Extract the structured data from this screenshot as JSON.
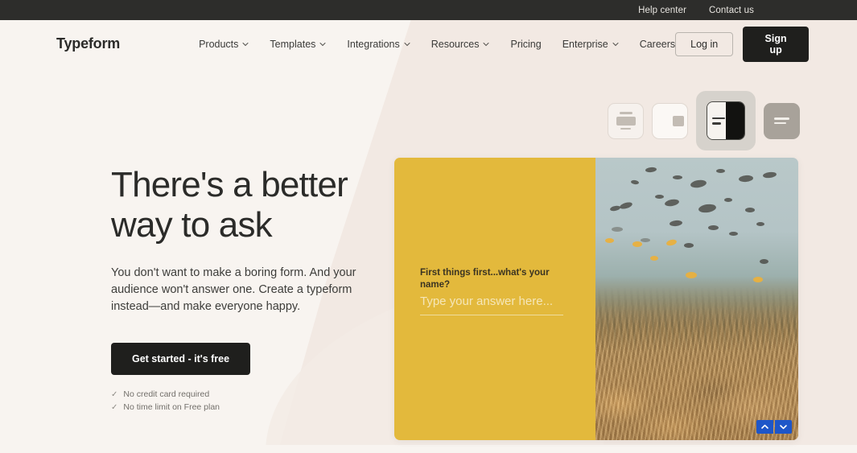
{
  "topbar": {
    "links": [
      {
        "label": "Help center"
      },
      {
        "label": "Contact us"
      }
    ]
  },
  "header": {
    "logo": "Typeform",
    "nav": [
      {
        "label": "Products",
        "has_chevron": true
      },
      {
        "label": "Templates",
        "has_chevron": true
      },
      {
        "label": "Integrations",
        "has_chevron": true
      },
      {
        "label": "Resources",
        "has_chevron": true
      },
      {
        "label": "Pricing",
        "has_chevron": false
      },
      {
        "label": "Enterprise",
        "has_chevron": true
      },
      {
        "label": "Careers",
        "has_chevron": false
      }
    ],
    "login_label": "Log in",
    "signup_label": "Sign up"
  },
  "layout_switcher": {
    "options": [
      {
        "name": "layout-stacked",
        "selected": false
      },
      {
        "name": "layout-side-small",
        "selected": false
      },
      {
        "name": "layout-split",
        "selected": true
      },
      {
        "name": "layout-full",
        "selected": false
      }
    ],
    "selected_index": 2
  },
  "hero": {
    "heading": "There's a better way to ask",
    "paragraph": "You don't want to make a boring form. And your audience won't answer one. Create a typeform instead—and make everyone happy.",
    "cta_label": "Get started - it's free",
    "perks": [
      {
        "tick": "✓",
        "label": "No credit card required"
      },
      {
        "tick": "✓",
        "label": "No time limit on Free plan"
      }
    ]
  },
  "form_preview": {
    "question": "First things first...what's your name?",
    "answer_placeholder": "Type your answer here...",
    "panel_color": "#e3b93c",
    "nav_button_color": "#1e56c8",
    "nav_up_icon": "chevron-up-icon",
    "nav_down_icon": "chevron-down-icon",
    "image_alt": "underwater coral reef with fish"
  },
  "colors": {
    "topbar_bg": "#2d2d2b",
    "page_bg": "#f8f4f0",
    "wedge_bg": "#f1e8e2",
    "accent_dark": "#1f1f1d",
    "yellow": "#e3b93c",
    "blue": "#1e56c8"
  }
}
